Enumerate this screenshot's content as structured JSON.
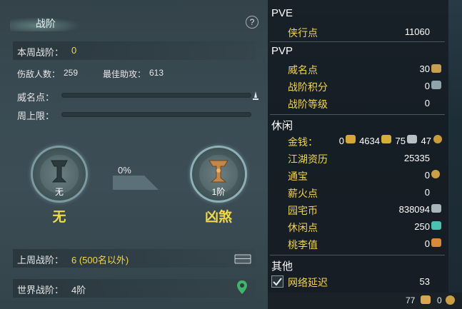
{
  "left": {
    "title": "战阶",
    "help": "?",
    "week_rank_label": "本周战阶：",
    "week_rank_value": "0",
    "kills_label": "伤敌人数：",
    "kills_value": "259",
    "assist_label": "最佳助攻：",
    "assist_value": "613",
    "prestige_label": "威名点：",
    "cap_label": "周上限：",
    "current_sub": "无",
    "current_name": "无",
    "progress_text": "0%",
    "next_sub": "1阶",
    "next_name": "凶煞",
    "last_week_label": "上周战阶：",
    "last_week_value": "6 (500名以外)",
    "world_rank_label": "世界战阶：",
    "world_rank_value": "4阶"
  },
  "right": {
    "pve": {
      "title": "PVE",
      "items": [
        {
          "label": "侠行点",
          "value": "11060"
        }
      ]
    },
    "pvp": {
      "title": "PVP",
      "items": [
        {
          "label": "威名点",
          "value": "30"
        },
        {
          "label": "战阶积分",
          "value": "0"
        },
        {
          "label": "战阶等级",
          "value": "0"
        }
      ]
    },
    "leisure": {
      "title": "休闲",
      "money_label": "金钱：",
      "money_values": [
        "0",
        "4634",
        "75",
        "47"
      ],
      "items": [
        {
          "label": "江湖资历",
          "value": "25335"
        },
        {
          "label": "通宝",
          "value": "0"
        },
        {
          "label": "薪火点",
          "value": "0"
        },
        {
          "label": "园宅币",
          "value": "838094"
        },
        {
          "label": "休闲点",
          "value": "250"
        },
        {
          "label": "桃李值",
          "value": "0"
        }
      ]
    },
    "other": {
      "title": "其他",
      "items": [
        {
          "label": "网络延迟",
          "value": "53"
        }
      ]
    },
    "bottom": {
      "count_a": "77",
      "count_b": "0"
    }
  },
  "colors": {
    "accent": "#f2d54a",
    "panel": "#3a4b53"
  }
}
